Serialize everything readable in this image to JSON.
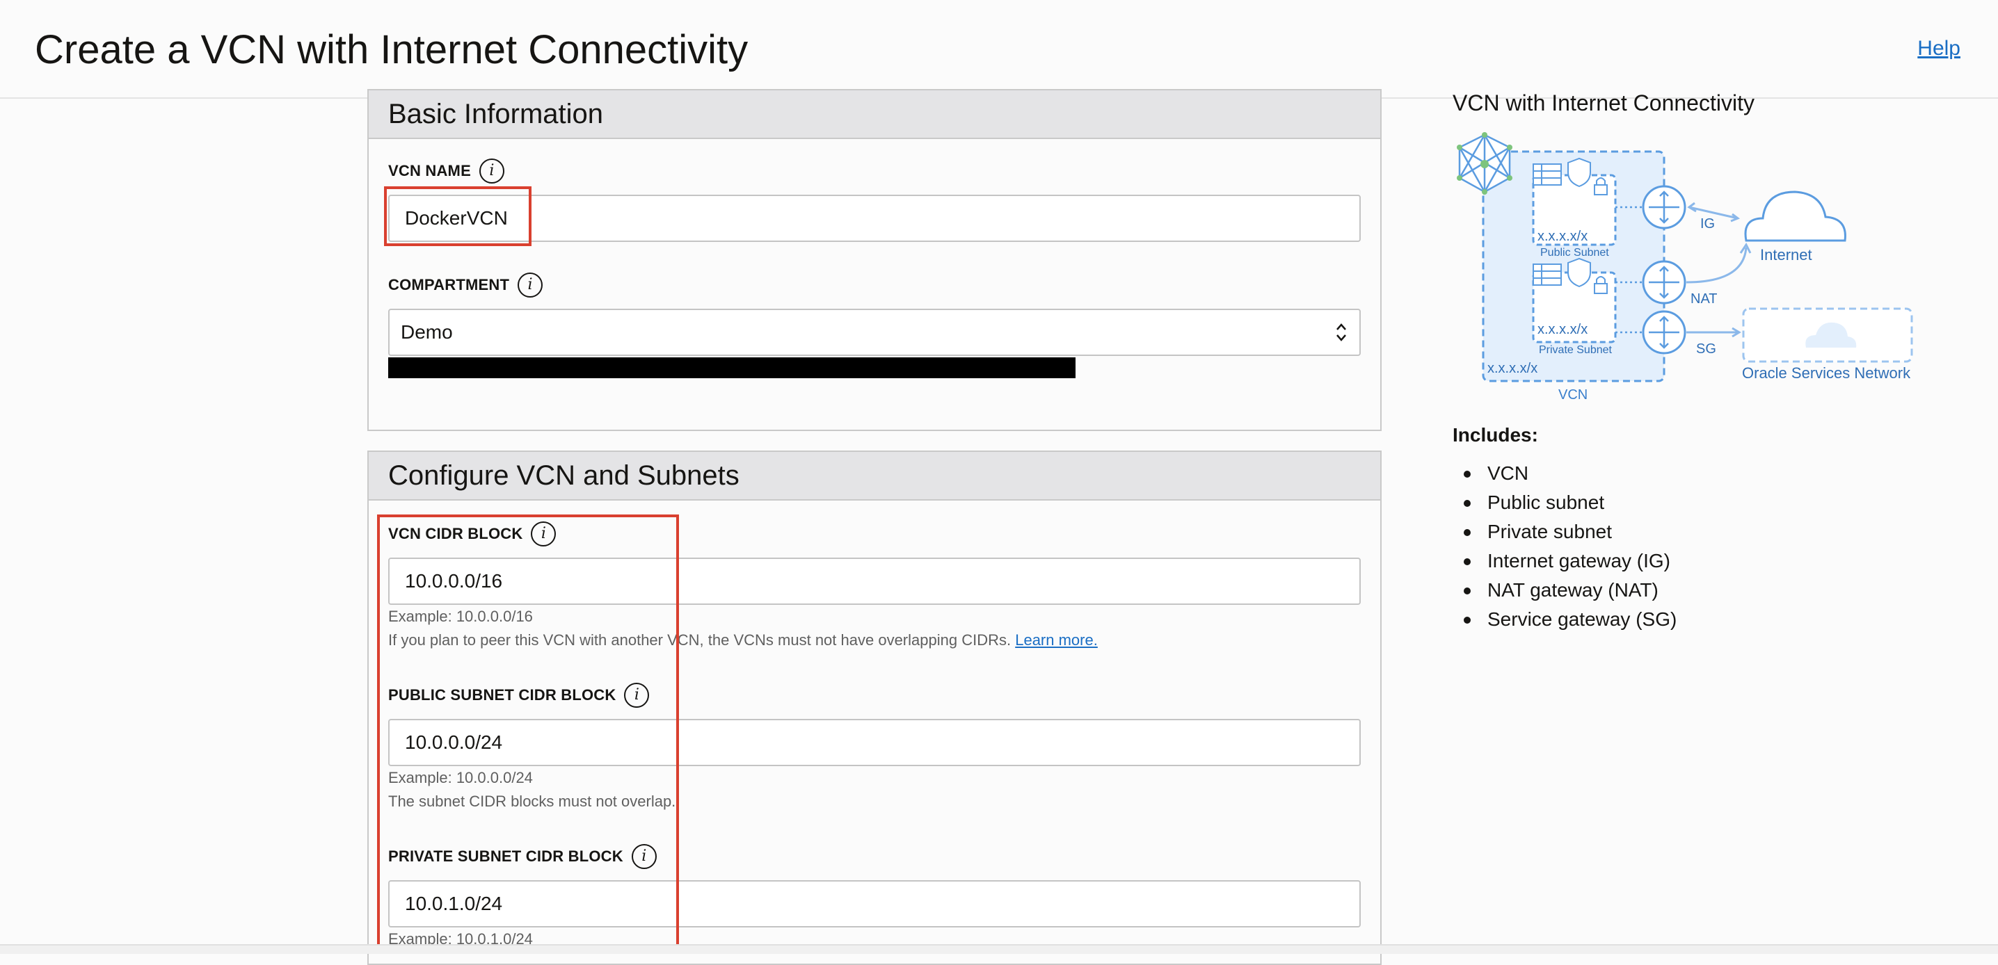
{
  "header": {
    "title": "Create a VCN with Internet Connectivity",
    "help_label": "Help"
  },
  "basic_info": {
    "section_title": "Basic Information",
    "vcn_name": {
      "label": "VCN NAME",
      "value": "DockerVCN"
    },
    "compartment": {
      "label": "COMPARTMENT",
      "value": "Demo"
    }
  },
  "configure": {
    "section_title": "Configure VCN and Subnets",
    "vcn_cidr": {
      "label": "VCN CIDR BLOCK",
      "value": "10.0.0.0/16",
      "example": "Example: 10.0.0.0/16",
      "note": "If you plan to peer this VCN with another VCN, the VCNs must not have overlapping CIDRs.",
      "learn_more": "Learn more."
    },
    "public_subnet": {
      "label": "PUBLIC SUBNET CIDR BLOCK",
      "value": "10.0.0.0/24",
      "example": "Example: 10.0.0.0/24",
      "note": "The subnet CIDR blocks must not overlap."
    },
    "private_subnet": {
      "label": "PRIVATE SUBNET CIDR BLOCK",
      "value": "10.0.1.0/24",
      "example": "Example: 10.0.1.0/24"
    }
  },
  "diagram": {
    "title": "VCN with Internet Connectivity",
    "cidr_placeholder": "x.x.x.x/x",
    "public_subnet": "Public Subnet",
    "private_subnet": "Private Subnet",
    "vcn": "VCN",
    "ig": "IG",
    "nat": "NAT",
    "sg": "SG",
    "internet": "Internet",
    "oracle_services": "Oracle Services Network",
    "line_color": "#5b9ce0",
    "fill_color": "#e3effc"
  },
  "includes": {
    "title": "Includes:",
    "items": [
      "VCN",
      "Public subnet",
      "Private subnet",
      "Internet gateway (IG)",
      "NAT gateway (NAT)",
      "Service gateway (SG)"
    ]
  },
  "colors": {
    "accent_link": "#1a6ec4",
    "highlight_box": "#d9402f"
  }
}
